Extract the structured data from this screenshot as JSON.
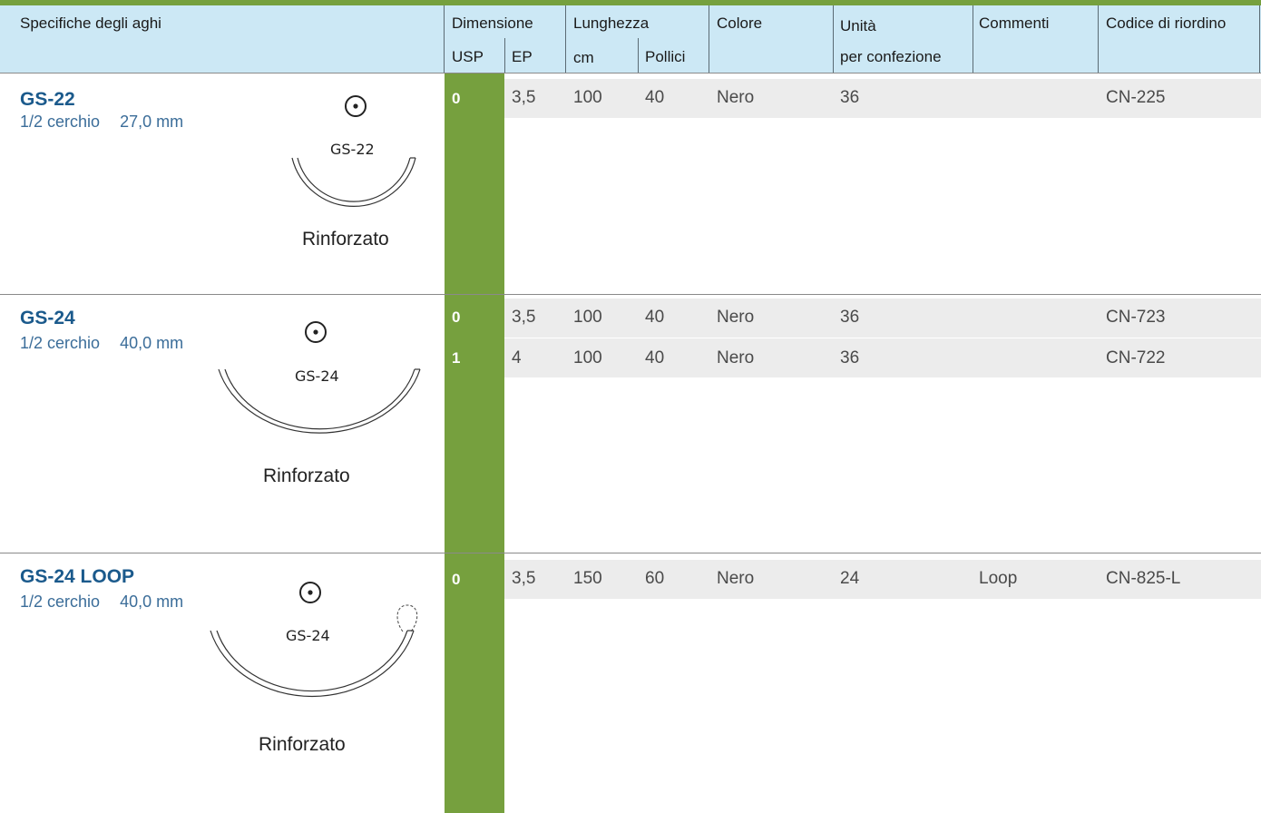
{
  "header": {
    "specs": "Specifiche degli aghi",
    "size": "Dimensione",
    "usp": "USP",
    "ep": "EP",
    "length": "Lunghezza",
    "cm": "cm",
    "inches": "Pollici",
    "color": "Colore",
    "units": "Unità",
    "per_pack": "per confezione",
    "comments": "Commenti",
    "order_code": "Codice di riordino"
  },
  "needles": [
    {
      "name": "GS-22",
      "shape": "1/2 cerchio",
      "size_mm": "27,0 mm",
      "illustration_label": "GS-22",
      "illustration_type": "Rinforzato",
      "icon": "round-body-symbol-icon",
      "rows": [
        {
          "usp": "0",
          "ep": "3,5",
          "cm": "100",
          "inches": "40",
          "color": "Nero",
          "units": "36",
          "comment": "",
          "code": "CN-225"
        }
      ]
    },
    {
      "name": "GS-24",
      "shape": "1/2 cerchio",
      "size_mm": "40,0 mm",
      "illustration_label": "GS-24",
      "illustration_type": "Rinforzato",
      "icon": "round-body-symbol-icon",
      "rows": [
        {
          "usp": "0",
          "ep": "3,5",
          "cm": "100",
          "inches": "40",
          "color": "Nero",
          "units": "36",
          "comment": "",
          "code": "CN-723"
        },
        {
          "usp": "1",
          "ep": "4",
          "cm": "100",
          "inches": "40",
          "color": "Nero",
          "units": "36",
          "comment": "",
          "code": "CN-722"
        }
      ]
    },
    {
      "name": "GS-24 LOOP",
      "shape": "1/2 cerchio",
      "size_mm": "40,0 mm",
      "illustration_label": "GS-24",
      "illustration_type": "Rinforzato",
      "icon": "round-body-symbol-icon",
      "rows": [
        {
          "usp": "0",
          "ep": "3,5",
          "cm": "150",
          "inches": "60",
          "color": "Nero",
          "units": "24",
          "comment": "Loop",
          "code": "CN-825-L"
        }
      ]
    }
  ],
  "colors": {
    "accent_green": "#76a03e",
    "header_blue": "#cce8f5",
    "title_blue": "#1b5a8c"
  }
}
